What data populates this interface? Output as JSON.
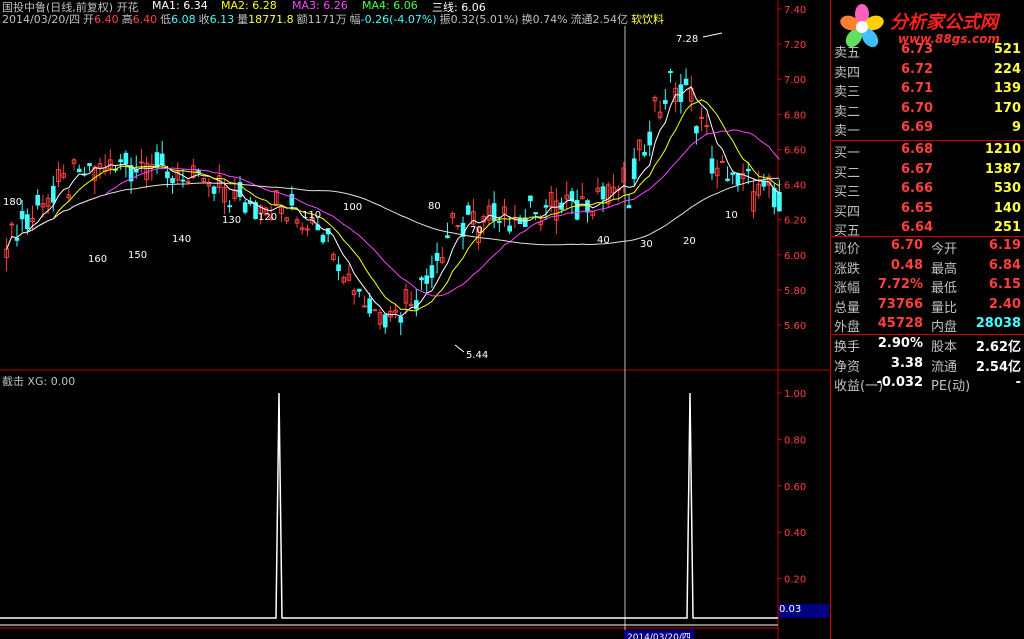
{
  "header": {
    "title": "国投中鲁(日线,前复权) 开花",
    "ma": [
      {
        "label": "MA1: 6.34",
        "color": "#ffffff"
      },
      {
        "label": "MA2: 6.28",
        "color": "#ffff00"
      },
      {
        "label": "MA3: 6.26",
        "color": "#ff40ff"
      },
      {
        "label": "MA4: 6.06",
        "color": "#40ff40"
      },
      {
        "label": "三线: 6.06",
        "color": "#ffffff"
      }
    ],
    "ohlc": {
      "date": "2014/03/20/四",
      "open_label": "开",
      "open": "6.40",
      "high_label": "高",
      "high": "6.40",
      "low_label": "低",
      "low": "6.08",
      "close_label": "收",
      "close": "6.13",
      "volume_label": "量",
      "volume": "18771.8",
      "amount_label": "额",
      "amount": "1171万",
      "change_label": "幅",
      "change": "-0.26(-4.07%)",
      "amp_label": "振",
      "amp": "0.32(5.01%)",
      "turnover": "换0.74%",
      "float": "流通2.54亿",
      "industry": "软饮料"
    }
  },
  "main_chart": {
    "y_ticks": [
      "7.40",
      "7.20",
      "7.00",
      "6.80",
      "6.60",
      "6.40",
      "6.20",
      "6.00",
      "5.80",
      "5.60"
    ],
    "high_mark": "7.28",
    "low_mark": "5.44",
    "ma_labels": [
      "180",
      "160",
      "150",
      "140",
      "130",
      "120",
      "110",
      "100",
      "80",
      "70",
      "40",
      "30",
      "20",
      "10"
    ]
  },
  "sub_chart": {
    "title": "截击 XG: 0.00",
    "y_ticks": [
      "1.00",
      "0.80",
      "0.60",
      "0.40",
      "0.20"
    ],
    "current_value": "0.03"
  },
  "x_axis": {
    "cursor_date": "2014/03/20/四"
  },
  "logo": {
    "text": "分析家公式网",
    "url": "www.88gs.com"
  },
  "order_book": {
    "sell": [
      {
        "label": "卖五",
        "price": "6.73",
        "vol": "521"
      },
      {
        "label": "卖四",
        "price": "6.72",
        "vol": "224"
      },
      {
        "label": "卖三",
        "price": "6.71",
        "vol": "139"
      },
      {
        "label": "卖二",
        "price": "6.70",
        "vol": "170"
      },
      {
        "label": "卖一",
        "price": "6.69",
        "vol": "9"
      }
    ],
    "buy": [
      {
        "label": "买一",
        "price": "6.68",
        "vol": "1210"
      },
      {
        "label": "买二",
        "price": "6.67",
        "vol": "1387"
      },
      {
        "label": "买三",
        "price": "6.66",
        "vol": "530"
      },
      {
        "label": "买四",
        "price": "6.65",
        "vol": "140"
      },
      {
        "label": "买五",
        "price": "6.64",
        "vol": "251"
      }
    ]
  },
  "quote": [
    {
      "l1": "现价",
      "v1": "6.70",
      "l2": "今开",
      "v2": "6.19",
      "c2": "#ff4040"
    },
    {
      "l1": "涨跌",
      "v1": "0.48",
      "l2": "最高",
      "v2": "6.84",
      "c2": "#ff4040"
    },
    {
      "l1": "涨幅",
      "v1": "7.72%",
      "l2": "最低",
      "v2": "6.15",
      "c2": "#ff4040"
    },
    {
      "l1": "总量",
      "v1": "73766",
      "l2": "量比",
      "v2": "2.40",
      "c2": "#ff4040"
    },
    {
      "l1": "外盘",
      "v1": "45728",
      "l2": "内盘",
      "v2": "28038",
      "c2": "#40ffff"
    }
  ],
  "fundamentals": [
    {
      "l1": "换手",
      "v1": "2.90%",
      "l2": "股本",
      "v2": "2.62亿"
    },
    {
      "l1": "净资",
      "v1": "3.38",
      "l2": "流通",
      "v2": "2.54亿"
    },
    {
      "l1": "收益(一)",
      "v1": "-0.032",
      "l2": "PE(动)",
      "v2": "-"
    }
  ],
  "colors": {
    "up": "#ff4040",
    "down": "#40ffff",
    "grid": "#c00000",
    "background": "#000000"
  }
}
